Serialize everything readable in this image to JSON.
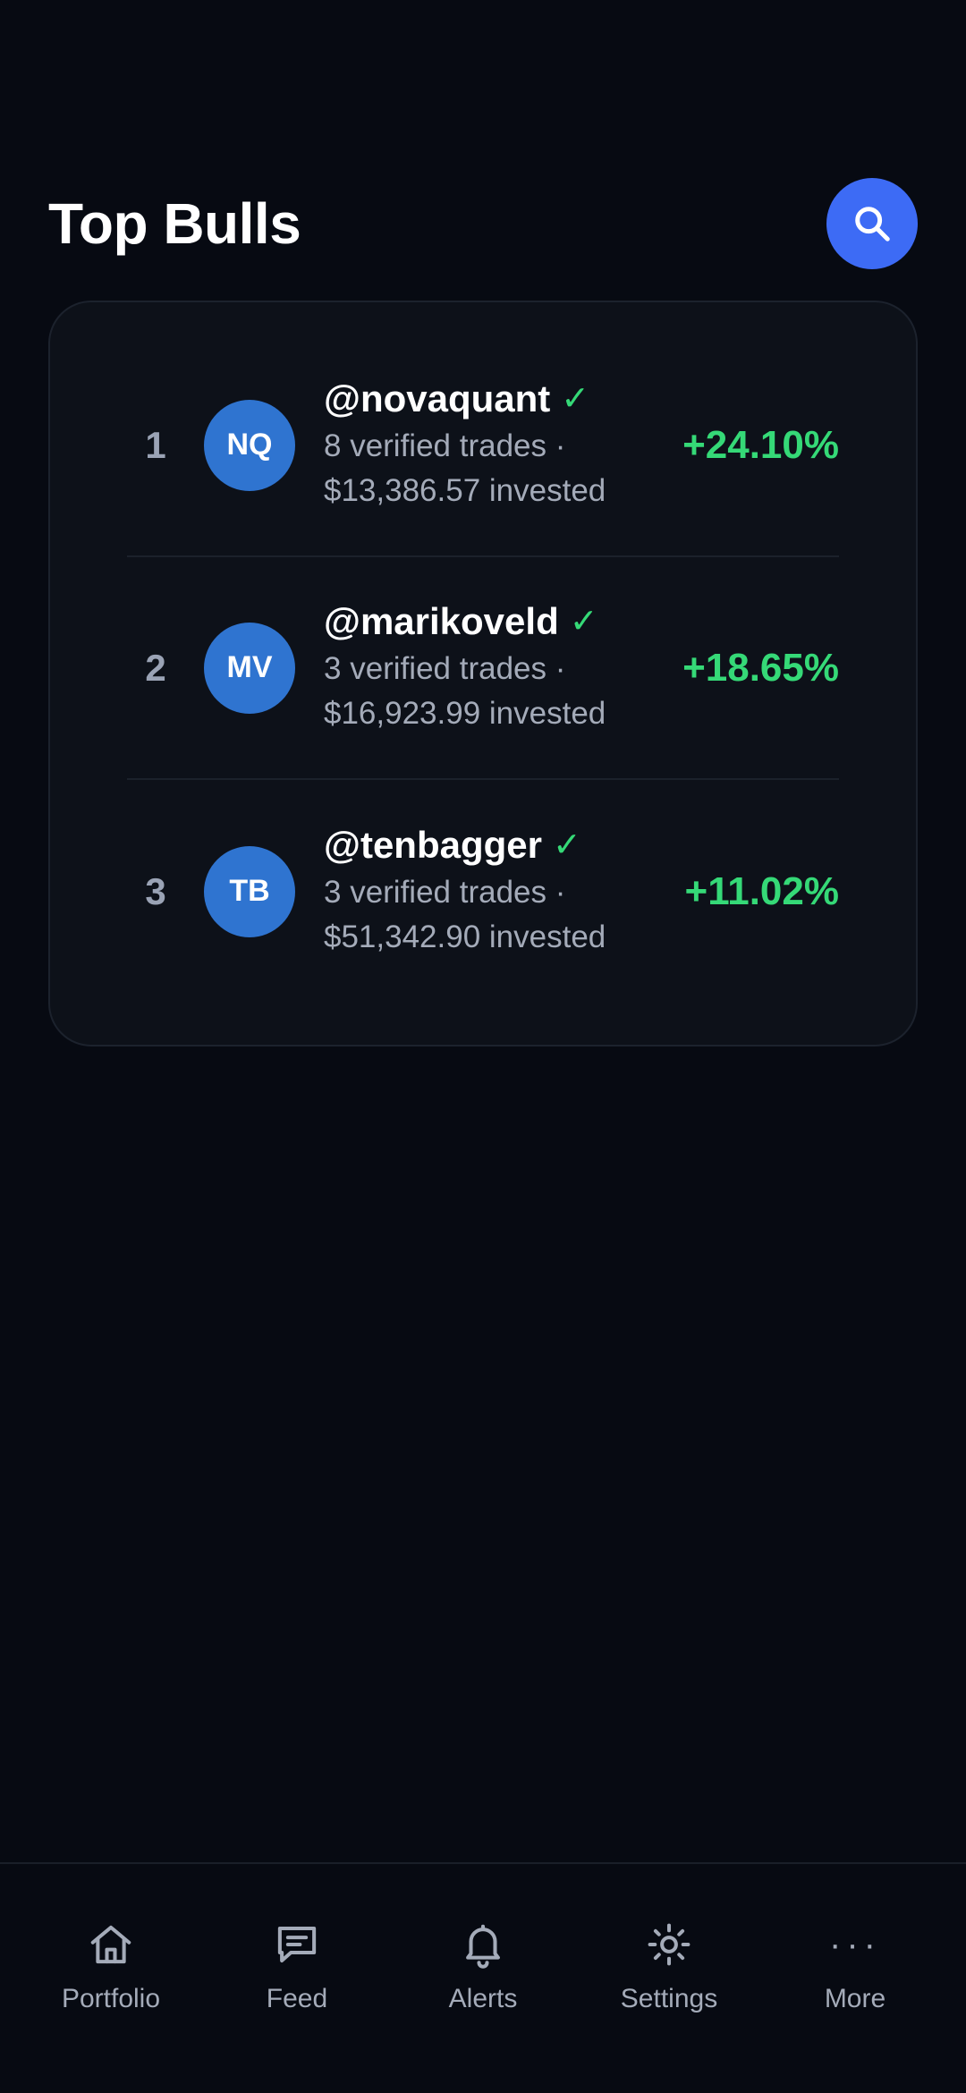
{
  "header": {
    "title": "Top Bulls",
    "search_icon": "search-icon"
  },
  "leaderboard": [
    {
      "rank": "1",
      "initials": "NQ",
      "handle": "@novaquant",
      "verified_mark": "✓",
      "trades": "8 verified trades ·",
      "invested": "$13,386.57 invested",
      "gain": "+24.10%"
    },
    {
      "rank": "2",
      "initials": "MV",
      "handle": "@marikoveld",
      "verified_mark": "✓",
      "trades": "3 verified trades ·",
      "invested": "$16,923.99 invested",
      "gain": "+18.65%"
    },
    {
      "rank": "3",
      "initials": "TB",
      "handle": "@tenbagger",
      "verified_mark": "✓",
      "trades": "3 verified trades ·",
      "invested": "$51,342.90 invested",
      "gain": "+11.02%"
    }
  ],
  "nav": {
    "items": [
      {
        "label": "Portfolio",
        "icon": "home-icon"
      },
      {
        "label": "Feed",
        "icon": "chat-icon"
      },
      {
        "label": "Alerts",
        "icon": "bell-icon"
      },
      {
        "label": "Settings",
        "icon": "gear-icon"
      },
      {
        "label": "More",
        "icon": "more-dots-icon",
        "glyph": "···"
      }
    ]
  },
  "colors": {
    "background": "#070a12",
    "card": "#0d1119",
    "accent": "#3d6bf5",
    "avatar": "#2f74d0",
    "positive": "#35d977",
    "muted_text": "#a4abb9"
  }
}
